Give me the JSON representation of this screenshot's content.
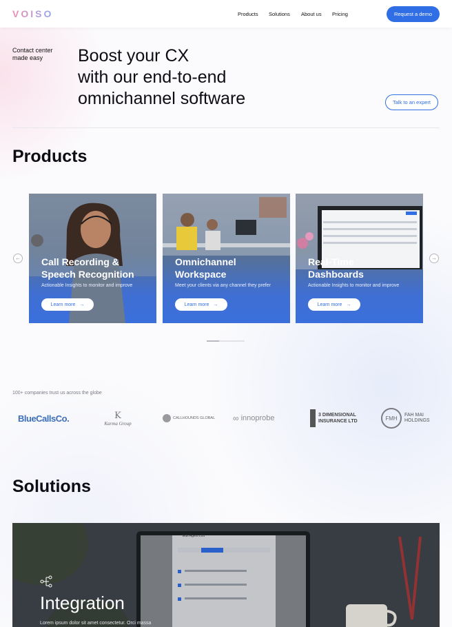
{
  "header": {
    "logo": "VOISO",
    "nav": [
      "Products",
      "Solutions",
      "About us",
      "Pricing"
    ],
    "demo_button": "Request a demo"
  },
  "hero": {
    "tagline": "Contact center made easy",
    "title_lines": [
      "Boost your CX",
      "with our end-to-end",
      "omnichannel software"
    ],
    "talk_button": "Talk to an expert"
  },
  "products": {
    "title": "Products",
    "prev_icon": "arrow-left-icon",
    "next_icon": "arrow-right-icon",
    "cards": [
      {
        "title_lines": [
          "Call Recording &",
          "Speech Recognition"
        ],
        "desc": "Actionable Insights to monitor and improve",
        "button": "Learn more"
      },
      {
        "title_lines": [
          "Omnichannel",
          "Workspace"
        ],
        "desc": "Meet your clients via any channel they prefer",
        "button": "Learn more"
      },
      {
        "title_lines": [
          "Real-Time",
          "Dashboards"
        ],
        "desc": "Actionable Insights to monitor and improve",
        "button": "Learn more"
      }
    ],
    "progress": 0.33
  },
  "trust": {
    "label": "100+ companies trust us across the globe",
    "logos": [
      "BlueCallsCo.",
      "Karma Group",
      "CALLHOUNDS GLOBAL",
      "innoprobe",
      "3 DIMENSIONAL INSURANCE LTD",
      "FAH MAI HOLDINGS"
    ],
    "logo_extras": {
      "fmh_badge": "FMH",
      "fahmai_line1": "FAH MAI",
      "fahmai_line2": "HOLDINGS",
      "dim_line1": "3 DIMENSIONAL",
      "dim_line2": "INSURANCE LTD"
    }
  },
  "solutions": {
    "title": "Solutions",
    "banner_title": "Integration",
    "banner_desc": "Lorem ipsum dolor sit amet consectetur. Orci massa",
    "banner_icon": "integration-icon",
    "screen_title": "Edit Agent List"
  },
  "colors": {
    "accent": "#2f6ee5",
    "card_blue": "#3a6fdc"
  }
}
